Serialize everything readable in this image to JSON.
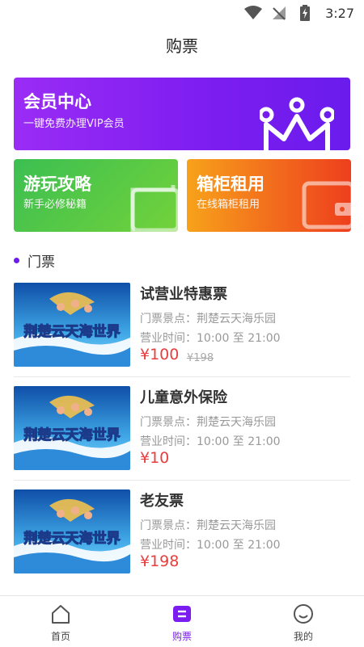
{
  "status_bar": {
    "time": "3:27",
    "icons": [
      "wifi-icon",
      "no-signal-icon",
      "battery-charging-icon"
    ]
  },
  "header": {
    "title": "购票"
  },
  "cards": {
    "member": {
      "title": "会员中心",
      "subtitle": "一键免费办理VIP会员",
      "icon": "crown-icon",
      "color": "#7c1df0"
    },
    "guide": {
      "title": "游玩攻略",
      "subtitle": "新手必修秘籍",
      "icon": "card-deco-icon",
      "color": "#4cc44a"
    },
    "locker": {
      "title": "箱柜租用",
      "subtitle": "在线箱柜租用",
      "icon": "wallet-deco-icon",
      "color": "#f2541d"
    }
  },
  "section": {
    "title": "门票"
  },
  "tickets": [
    {
      "name": "试营业特惠票",
      "place": "门票景点：荆楚云天海乐园",
      "hours": "营业时间：10:00 至 21:00",
      "price": "¥100",
      "original_price": "¥198",
      "image_text": "荆楚云天海世界"
    },
    {
      "name": "儿童意外保险",
      "place": "门票景点：荆楚云天海乐园",
      "hours": "营业时间：10:00 至 21:00",
      "price": "¥10",
      "original_price": "",
      "image_text": "荆楚云天海世界"
    },
    {
      "name": "老友票",
      "place": "门票景点：荆楚云天海乐园",
      "hours": "营业时间：10:00 至 21:00",
      "price": "¥198",
      "original_price": "",
      "image_text": "荆楚云天海世界"
    }
  ],
  "tabbar": {
    "items": [
      {
        "label": "首页",
        "icon": "home-icon",
        "active": false
      },
      {
        "label": "购票",
        "icon": "ticket-icon",
        "active": true
      },
      {
        "label": "我的",
        "icon": "smile-icon",
        "active": false
      }
    ],
    "accent": "#7c1df0"
  }
}
